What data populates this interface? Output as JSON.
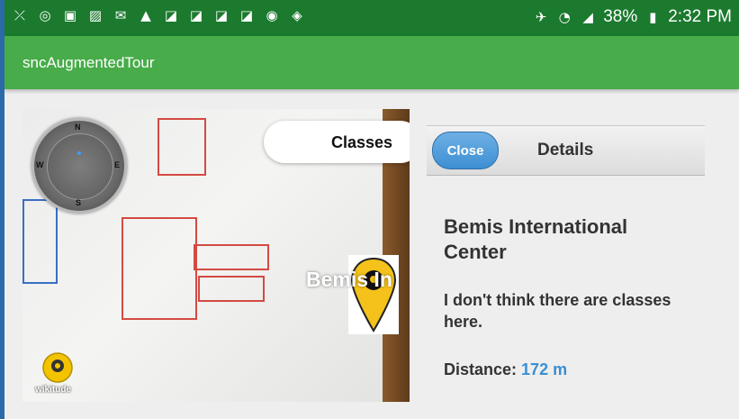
{
  "status_bar": {
    "left_icons": [
      "missed-call-icon",
      "sync-icon",
      "instagram-icon",
      "image-icon",
      "gmail-icon",
      "warning-icon",
      "flipboard-icon",
      "flipboard-icon",
      "flipboard-icon",
      "flipboard-icon",
      "voicemail-icon",
      "drive-icon"
    ],
    "battery": "38%",
    "time": "2:32 PM"
  },
  "app_bar": {
    "title": "sncAugmentedTour"
  },
  "camera": {
    "radar_directions": {
      "north": "N",
      "east": "E",
      "south": "S",
      "west": "W"
    },
    "filter_button": "Classes",
    "poi_label": "Bemis In",
    "logo_text": "wikitude"
  },
  "details": {
    "close_label": "Close",
    "header_title": "Details",
    "place_name": "Bemis International Center",
    "description": "I don't think there are classes here.",
    "distance_label": "Distance:",
    "distance_value": "172 m"
  },
  "colors": {
    "status_bar": "#1b7a2e",
    "app_bar": "#47ac49",
    "close_button": "#4a97d8",
    "distance_value": "#3a8fd3"
  }
}
